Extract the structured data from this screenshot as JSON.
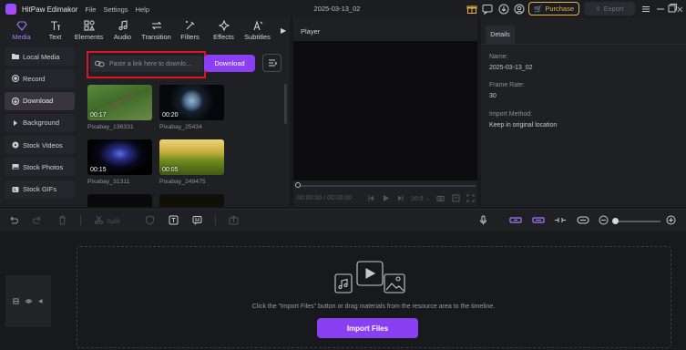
{
  "app": {
    "name": "HitPaw Edimakor",
    "menu": [
      "File",
      "Settings",
      "Help"
    ],
    "project_title": "2025-03-13_02",
    "purchase_label": "Purchase",
    "export_label": "Export"
  },
  "media_tabs": [
    {
      "label": "Media",
      "icon": "media-icon",
      "active": true
    },
    {
      "label": "Text",
      "icon": "text-icon"
    },
    {
      "label": "Elements",
      "icon": "elements-icon"
    },
    {
      "label": "Audio",
      "icon": "audio-icon"
    },
    {
      "label": "Transition",
      "icon": "transition-icon"
    },
    {
      "label": "Filters",
      "icon": "filters-icon"
    },
    {
      "label": "Effects",
      "icon": "effects-icon"
    },
    {
      "label": "Subtitles",
      "icon": "subtitles-icon"
    }
  ],
  "sidebar": {
    "items": [
      {
        "label": "Local Media",
        "icon": "folder-icon"
      },
      {
        "label": "Record",
        "icon": "record-icon"
      },
      {
        "label": "Download",
        "icon": "download-icon",
        "active": true
      },
      {
        "label": "Background",
        "icon": "background-icon"
      },
      {
        "label": "Stock Videos",
        "icon": "stock-videos-icon"
      },
      {
        "label": "Stock Photos",
        "icon": "stock-photos-icon"
      },
      {
        "label": "Stock GIFs",
        "icon": "stock-gifs-icon"
      }
    ]
  },
  "download": {
    "placeholder": "Paste a link here to downlo...",
    "button_label": "Download"
  },
  "thumbnails": [
    {
      "duration": "00:17",
      "name": "Pixabay_136331"
    },
    {
      "duration": "00:20",
      "name": "Pixabay_25434"
    },
    {
      "duration": "00:15",
      "name": "Pixabay_31311"
    },
    {
      "duration": "00:05",
      "name": "Pixabay_249475"
    }
  ],
  "player": {
    "label": "Player",
    "time_current": "00:00:00",
    "time_total": "00:00:00",
    "speed": "16:9"
  },
  "details": {
    "tab_label": "Details",
    "name_label": "Name:",
    "name_value": "2025-03-13_02",
    "frame_rate_label": "Frame Rate:",
    "frame_rate_value": "30",
    "import_method_label": "Import Method:",
    "import_method_value": "Keep in original location"
  },
  "toolbar": {
    "split_label": "Split"
  },
  "timeline": {
    "drop_text": "Click the \"Import Files\" button or drag materials from the resource area to the timeline.",
    "import_label": "Import Files"
  },
  "colors": {
    "accent": "#8a3ff2",
    "purchase": "#e7b24a",
    "highlight_box": "#e0141e",
    "active_tab": "#a67cff"
  }
}
